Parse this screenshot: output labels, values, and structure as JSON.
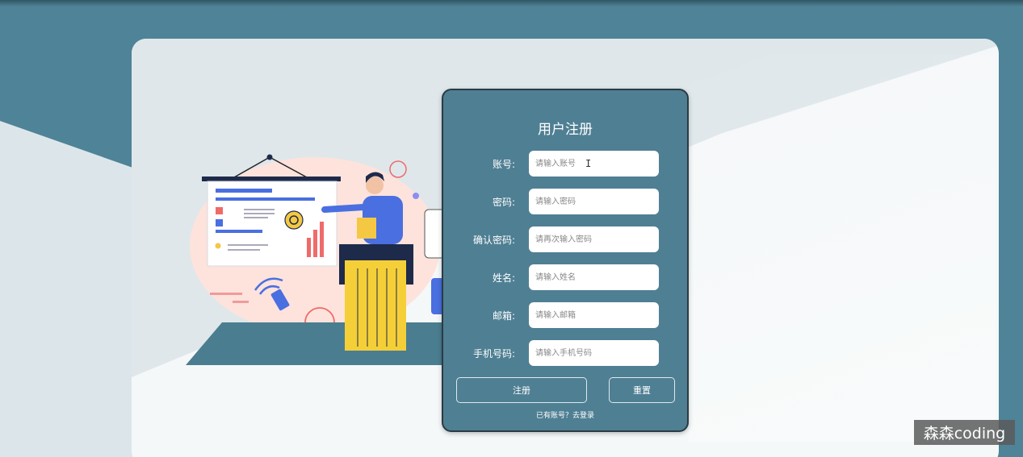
{
  "form": {
    "title": "用户注册",
    "fields": [
      {
        "label": "账号:",
        "placeholder": "请输入账号",
        "value": ""
      },
      {
        "label": "密码:",
        "placeholder": "请输入密码",
        "value": ""
      },
      {
        "label": "确认密码:",
        "placeholder": "请再次输入密码",
        "value": ""
      },
      {
        "label": "姓名:",
        "placeholder": "请输入姓名",
        "value": ""
      },
      {
        "label": "邮箱:",
        "placeholder": "请输入邮箱",
        "value": ""
      },
      {
        "label": "手机号码:",
        "placeholder": "请输入手机号码",
        "value": ""
      }
    ],
    "register_label": "注册",
    "reset_label": "重置",
    "login_link": "已有账号？去登录"
  },
  "watermark": "森森coding",
  "colors": {
    "background": "#4f8397",
    "panel": "#4f7f93",
    "card": "#f5f8f9"
  }
}
